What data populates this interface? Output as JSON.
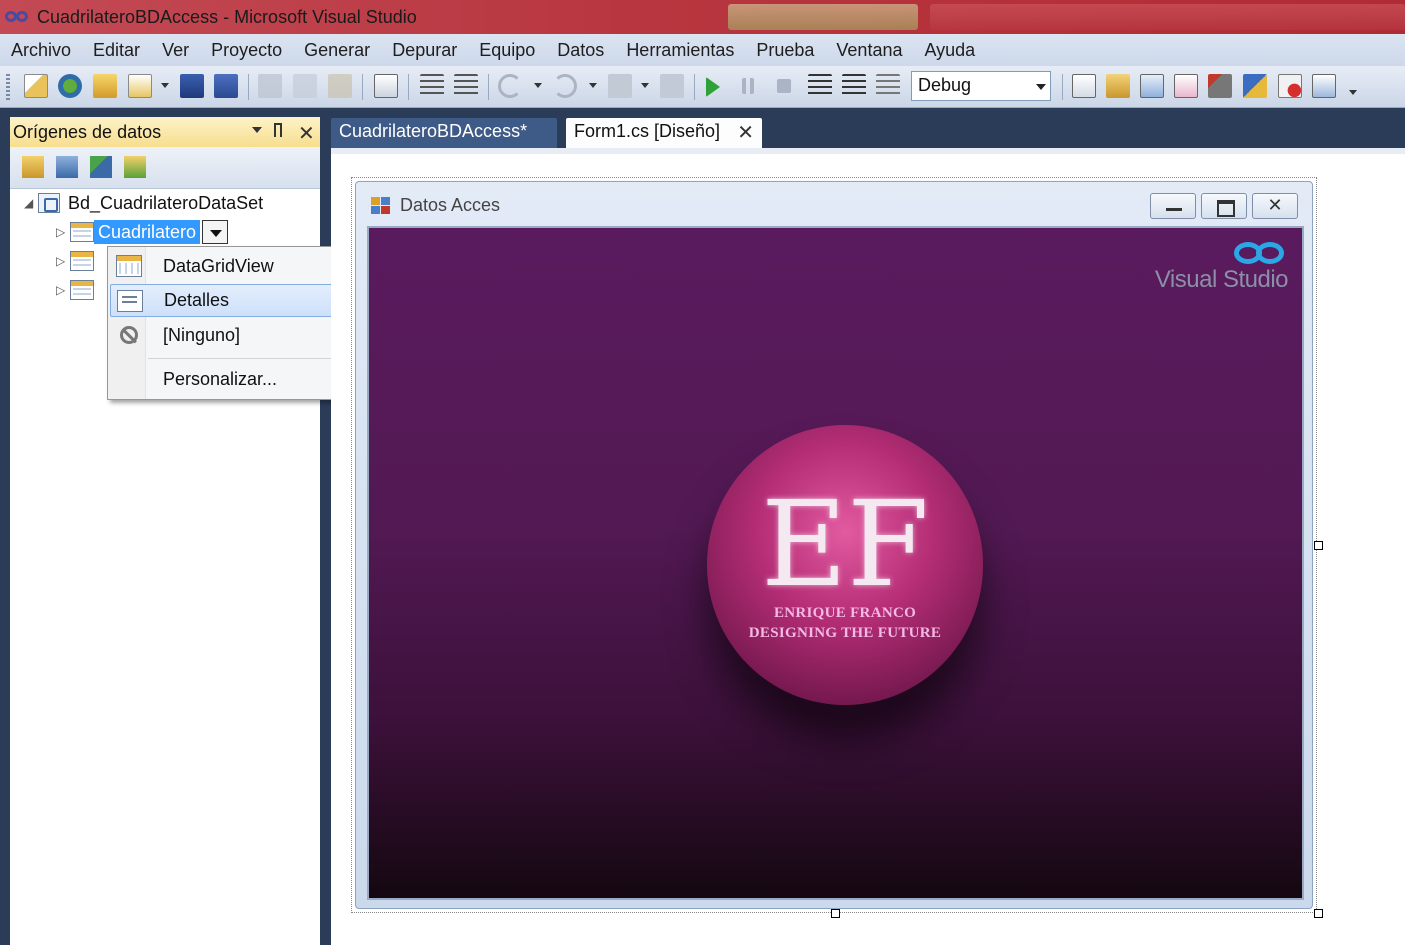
{
  "window": {
    "title": "CuadrilateroBDAccess - Microsoft Visual Studio"
  },
  "menu": [
    "Archivo",
    "Editar",
    "Ver",
    "Proyecto",
    "Generar",
    "Depurar",
    "Equipo",
    "Datos",
    "Herramientas",
    "Prueba",
    "Ventana",
    "Ayuda"
  ],
  "toolbar": {
    "config_value": "Debug"
  },
  "data_sources": {
    "title": "Orígenes de datos",
    "dataset": "Bd_CuadrilateroDataSet",
    "selected_table": "Cuadrilatero"
  },
  "context_menu": {
    "items": [
      "DataGridView",
      "Detalles",
      "[Ninguno]",
      "Personalizar..."
    ]
  },
  "tabs": [
    {
      "label": "CuadrilateroBDAccess*"
    },
    {
      "label": "Form1.cs [Diseño]"
    }
  ],
  "form": {
    "caption": "Datos Acces",
    "logo_text": "Visual Studio",
    "orb_initials": "EF",
    "orb_line1": "ENRIQUE FRANCO",
    "orb_line2": "DESIGNING THE FUTURE"
  },
  "colors": {
    "accent_selection": "#3399ff",
    "panel_header": "#f7de8e",
    "frame_bg": "#2b3c59"
  }
}
